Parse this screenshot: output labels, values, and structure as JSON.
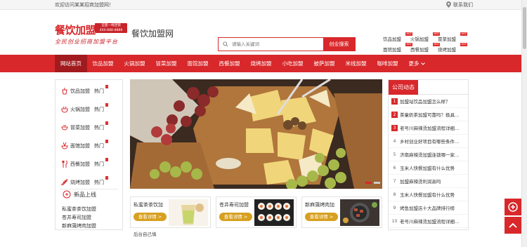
{
  "topbar": {
    "welcome": "欢迎访问某某招商加盟网！",
    "contact": "联系我们"
  },
  "logo": {
    "brand": "餐饮加盟",
    "badge_line1": "全国一线连锁",
    "badge_line2": "400-888-8888",
    "slogan": "全民创业招商加盟平台"
  },
  "sitename": "餐饮加盟网",
  "search": {
    "placeholder": "请输入关键词",
    "button": "创业搜索"
  },
  "hotlinks": [
    {
      "label": "饮品加盟",
      "tag": "HOT"
    },
    {
      "label": "火锅加盟",
      "tag": "HOT"
    },
    {
      "label": "冒菜加盟",
      "tag": "HOT"
    },
    {
      "label": "面馆加盟",
      "tag": "HOT"
    },
    {
      "label": "西餐加盟",
      "tag": "HOT"
    },
    {
      "label": "烧烤加盟",
      "tag": "HOT"
    }
  ],
  "nav": {
    "items": [
      "网站首页",
      "饮品加盟",
      "火锅加盟",
      "冒菜加盟",
      "面馆加盟",
      "西餐加盟",
      "烧烤加盟",
      "小吃加盟",
      "披萨加盟",
      "米线加盟",
      "咖啡加盟"
    ],
    "more": "更多"
  },
  "categories": [
    {
      "label": "饮品加盟",
      "hot": "热门",
      "icon": "cup-icon"
    },
    {
      "label": "火锅加盟",
      "hot": "热门",
      "icon": "hotpot-icon"
    },
    {
      "label": "冒菜加盟",
      "hot": "热门",
      "icon": "bowl-icon"
    },
    {
      "label": "面馆加盟",
      "hot": "热门",
      "icon": "noodle-icon"
    },
    {
      "label": "西餐加盟",
      "hot": "热门",
      "icon": "cutlery-icon"
    },
    {
      "label": "烧烤加盟",
      "hot": "热门",
      "icon": "grill-icon"
    }
  ],
  "new": {
    "title": "新品上线",
    "items": [
      "私蜜茶茶饮加盟",
      "苍井寿司加盟",
      "新麻蒲烤肉加盟"
    ]
  },
  "cards": [
    {
      "title": "私蜜茶茶饮加",
      "button": "查看详情 >"
    },
    {
      "title": "苍井寿司加盟",
      "button": "查看详情 >"
    },
    {
      "title": "新麻蒲烤肉加",
      "button": "查看详情 >"
    }
  ],
  "below": "后台自己填",
  "news": {
    "title": "公司动态",
    "items": [
      "加盟站饮品加盟怎么样？",
      "茶童奶茶加盟可靠吗？极具...",
      "老号川麻辣烫加盟流程详细...",
      "乡村创业好项目有哪些条件...",
      "济南麻辣烫加盟连锁哪一家...",
      "玉米人快餐加盟有什么优势",
      "加盟麻辣烫利润高吗",
      "玉米人快餐加盟有什么优势",
      "烤鱼加盟店十大品牌排行榜",
      "老号川麻辣烫加盟流程详细..."
    ]
  },
  "colors": {
    "accent": "#d8282b",
    "accent_dark": "#a11b1e",
    "button_gold": "#d8a020"
  }
}
